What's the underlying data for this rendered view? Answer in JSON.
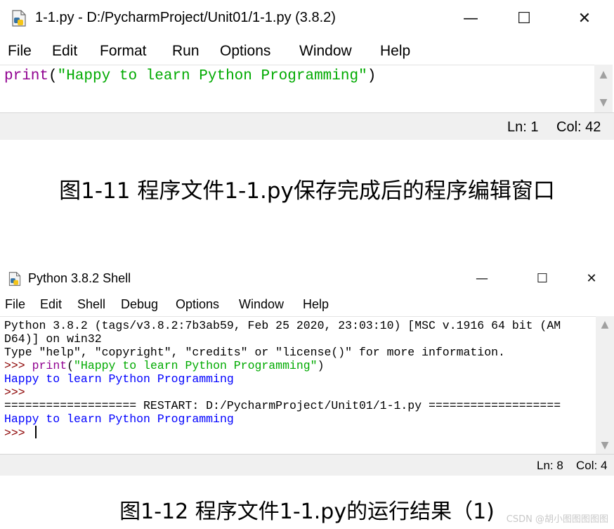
{
  "editor_window": {
    "title": "1-1.py - D:/PycharmProject/Unit01/1-1.py (3.8.2)",
    "controls": {
      "minimize": "—",
      "maximize": "☐",
      "close": "✕"
    },
    "menu": [
      "File",
      "Edit",
      "Format",
      "Run",
      "Options",
      "Window",
      "Help"
    ],
    "code": {
      "keyword": "print",
      "open": "(",
      "string": "\"Happy to learn Python Programming\"",
      "close": ")"
    },
    "status": {
      "line": "Ln: 1",
      "col": "Col: 42"
    }
  },
  "caption1": "图1-11  程序文件1-1.py保存完成后的程序编辑窗口",
  "shell_window": {
    "title": "Python 3.8.2 Shell",
    "controls": {
      "minimize": "—",
      "maximize": "☐",
      "close": "✕"
    },
    "menu": [
      "File",
      "Edit",
      "Shell",
      "Debug",
      "Options",
      "Window",
      "Help"
    ],
    "lines": {
      "banner1": "Python 3.8.2 (tags/v3.8.2:7b3ab59, Feb 25 2020, 23:03:10) [MSC v.1916 64 bit (AM",
      "banner2": "D64)] on win32",
      "banner3": "Type \"help\", \"copyright\", \"credits\" or \"license()\" for more information.",
      "prompt": ">>> ",
      "cmd_keyword": "print",
      "cmd_open": "(",
      "cmd_string": "\"Happy to learn Python Programming\"",
      "cmd_close": ")",
      "output1": "Happy to learn Python Programming",
      "empty_prompt": ">>>",
      "restart": "=================== RESTART: D:/PycharmProject/Unit01/1-1.py ===================",
      "output2": "Happy to learn Python Programming",
      "last_prompt": ">>> "
    },
    "status": {
      "line": "Ln: 8",
      "col": "Col: 4"
    }
  },
  "caption2": "图1-12  程序文件1-1.py的运行结果（1)",
  "watermark": "CSDN @胡小图图图图图"
}
